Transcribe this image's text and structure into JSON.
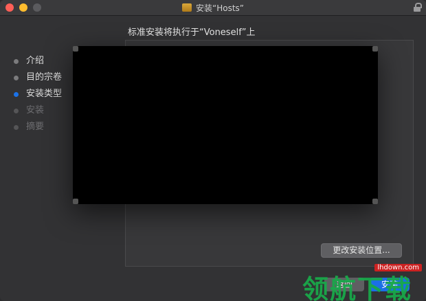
{
  "window": {
    "title": "安装“Hosts”",
    "heading": "标准安装将执行于“Voneself”上"
  },
  "steps": [
    {
      "label": "介绍",
      "state": "done"
    },
    {
      "label": "目的宗卷",
      "state": "done"
    },
    {
      "label": "安装类型",
      "state": "active"
    },
    {
      "label": "安装",
      "state": "disabled"
    },
    {
      "label": "摘要",
      "state": "disabled"
    }
  ],
  "buttons": {
    "change_location": "更改安装位置...",
    "back": "返回",
    "install": "安装"
  },
  "watermark": {
    "site": "lhdown.com",
    "brand": "领航下载"
  }
}
